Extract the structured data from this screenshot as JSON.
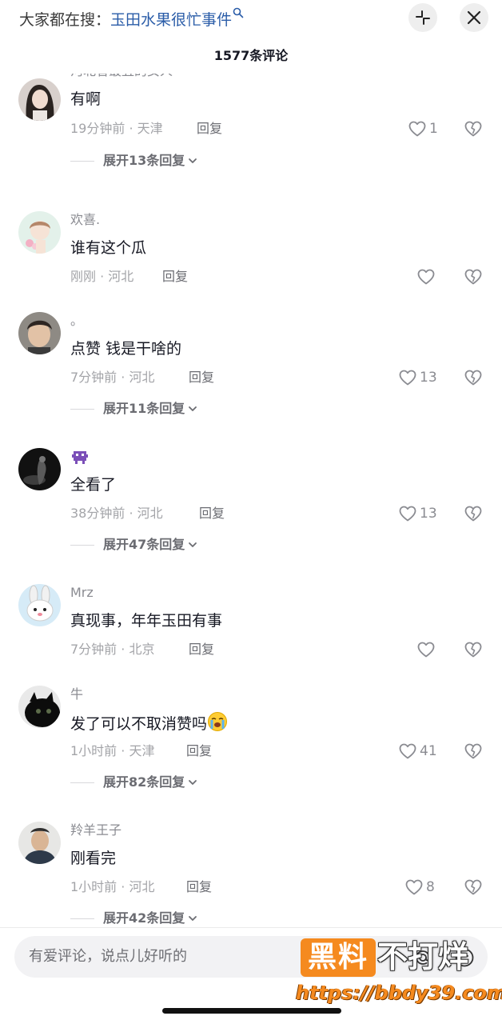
{
  "header": {
    "search_prefix": "大家都在搜：",
    "search_keyword": "玉田水果很忙事件",
    "comment_count_title": "1577条评论"
  },
  "comments": [
    {
      "username": "河北省最丑的女人",
      "text": "有啊",
      "time_location": "19分钟前 · 天津",
      "reply_label": "回复",
      "likes": "1",
      "expand_label": "展开13条回复"
    },
    {
      "username": "欢喜.",
      "text": "谁有这个瓜",
      "time_location": "刚刚 · 河北",
      "reply_label": "回复",
      "likes": "",
      "expand_label": ""
    },
    {
      "username": "。",
      "text": "点赞 钱是干啥的",
      "time_location": "7分钟前 · 河北",
      "reply_label": "回复",
      "likes": "13",
      "expand_label": "展开11条回复"
    },
    {
      "username": "",
      "text": "全看了",
      "time_location": "38分钟前 · 河北",
      "reply_label": "回复",
      "likes": "13",
      "expand_label": "展开47条回复"
    },
    {
      "username": "Mrz",
      "text": "真现事，年年玉田有事",
      "time_location": "7分钟前 · 北京",
      "reply_label": "回复",
      "likes": "",
      "expand_label": ""
    },
    {
      "username": "牛",
      "text": "发了可以不取消赞吗",
      "time_location": "1小时前 · 天津",
      "reply_label": "回复",
      "likes": "41",
      "expand_label": "展开82条回复"
    },
    {
      "username": "羚羊王子",
      "text": "刚看完",
      "time_location": "1小时前 · 河北",
      "reply_label": "回复",
      "likes": "8",
      "expand_label": "展开42条回复"
    }
  ],
  "input": {
    "placeholder": "有爱评论，说点儿好听的"
  },
  "watermark": {
    "box_text": "黑料",
    "side_text": "不打烊",
    "url": "https://bbdy39.com"
  },
  "colors": {
    "keyword_blue": "#2a5ca8",
    "watermark_orange": "#f58a1f"
  },
  "icons": [
    "search-icon",
    "collapse-icon",
    "close-icon",
    "heart-icon",
    "broken-heart-icon",
    "chevron-down-icon",
    "at-icon",
    "emoji-icon"
  ]
}
